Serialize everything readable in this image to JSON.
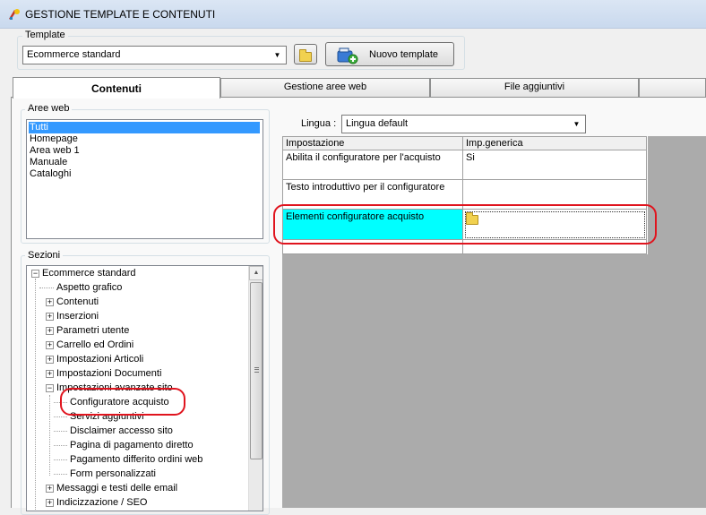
{
  "window": {
    "title": "GESTIONE TEMPLATE E CONTENUTI"
  },
  "template": {
    "label": "Template",
    "selected": "Ecommerce standard",
    "new_button": "Nuovo template"
  },
  "tabs": [
    {
      "label": "Contenuti",
      "active": true
    },
    {
      "label": "Gestione aree web",
      "active": false
    },
    {
      "label": "File aggiuntivi",
      "active": false
    }
  ],
  "aree_web": {
    "label": "Aree web",
    "items": [
      "Tutti",
      "Homepage",
      "Area web 1",
      "Manuale",
      "Cataloghi"
    ],
    "selected_index": 0
  },
  "sezioni": {
    "label": "Sezioni",
    "nodes": [
      "Ecommerce standard",
      "Aspetto grafico",
      "Contenuti",
      "Inserzioni",
      "Parametri utente",
      "Carrello ed Ordini",
      "Impostazioni Articoli",
      "Impostazioni Documenti",
      "Impostazioni avanzate sito",
      "Configuratore acquisto",
      "Servizi aggiuntivi",
      "Disclaimer accesso sito",
      "Pagina di pagamento diretto",
      "Pagamento differito ordini web",
      "Form personalizzati",
      "Messaggi e testi delle email",
      "Indicizzazione / SEO"
    ]
  },
  "lingua": {
    "label": "Lingua :",
    "selected": "Lingua default"
  },
  "grid": {
    "headers": [
      "Impostazione",
      "Imp.generica"
    ],
    "rows": [
      {
        "name": "Abilita il configuratore per l'acquisto",
        "value": "Si"
      },
      {
        "name": "Testo introduttivo per il configuratore",
        "value": ""
      },
      {
        "name": "Elementi configuratore acquisto",
        "value": ""
      },
      {
        "name": "",
        "value": ""
      }
    ]
  },
  "colors": {
    "selection": "#3399ff",
    "highlight": "#00ffff",
    "annotation": "#e0141e"
  }
}
